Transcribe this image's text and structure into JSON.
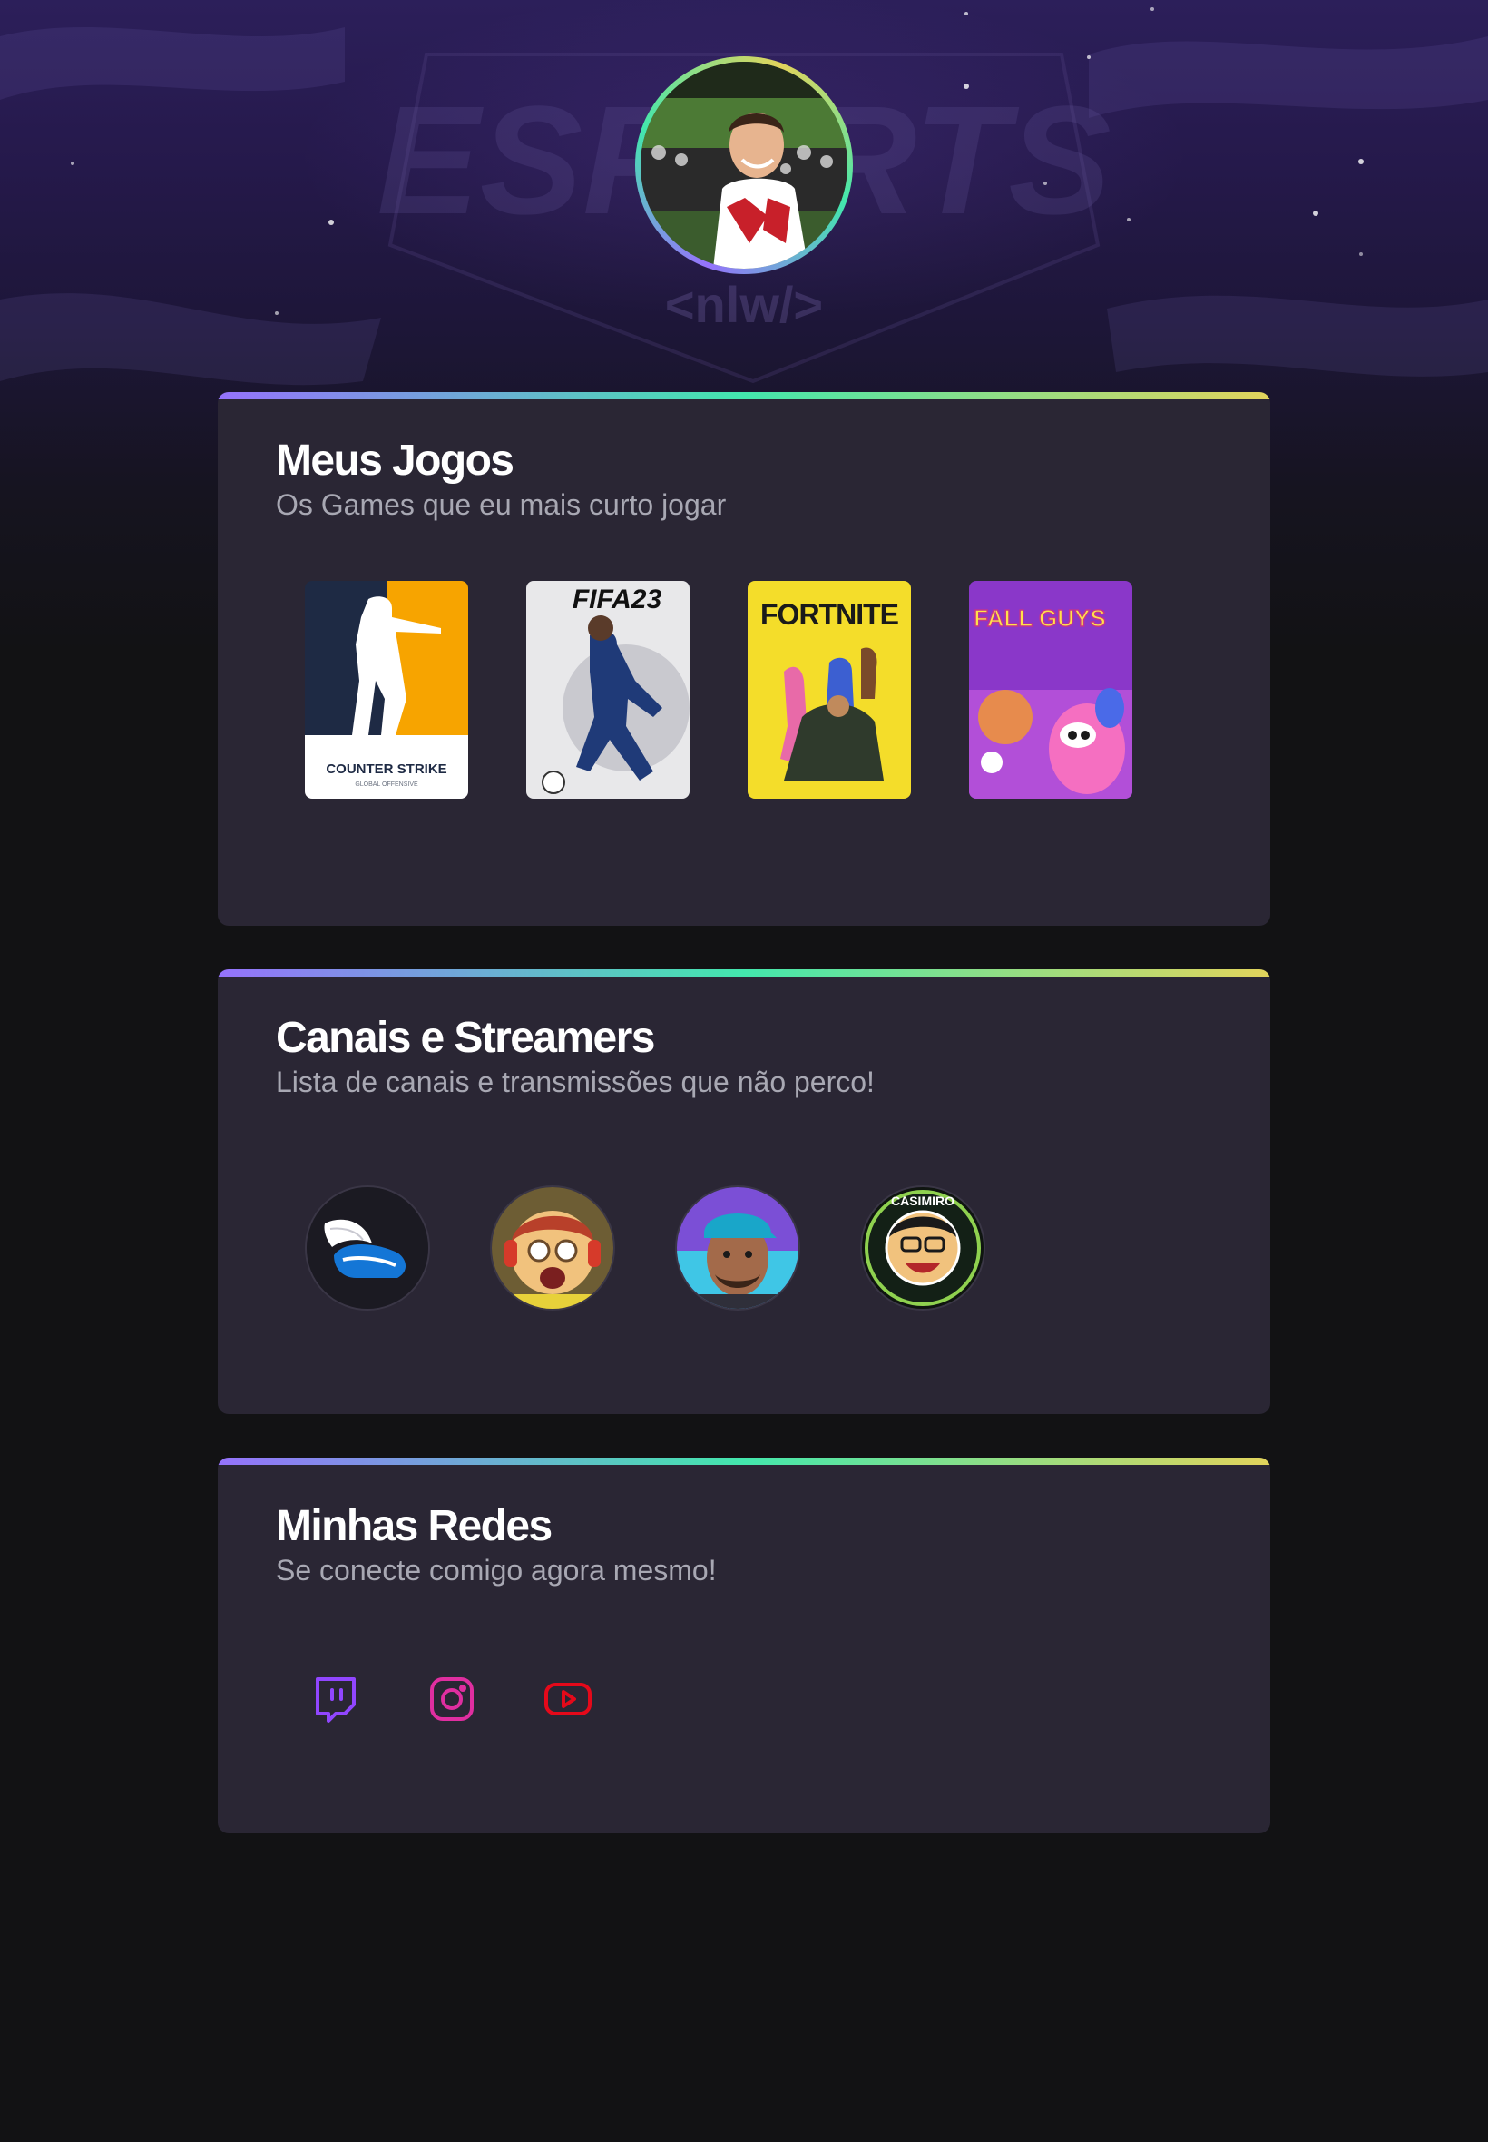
{
  "profile": {
    "avatar_alt": "Foto de perfil",
    "background_logo_text": "ESPORTS",
    "background_tag_text": "<nlw/>"
  },
  "sections": {
    "games": {
      "title": "Meus Jogos",
      "subtitle": "Os Games que eu mais curto jogar",
      "items": [
        {
          "name": "Counter Strike",
          "cover_text": "COUNTER STRIKE",
          "cover_subtext": "GLOBAL OFFENSIVE"
        },
        {
          "name": "FIFA 23",
          "cover_text": "FIFA23"
        },
        {
          "name": "Fortnite",
          "cover_text": "FORTNITE"
        },
        {
          "name": "Fall Guys",
          "cover_text": "FALL GUYS"
        }
      ]
    },
    "streamers": {
      "title": "Canais e Streamers",
      "subtitle": "Lista de canais e transmissões que não perco!",
      "items": [
        {
          "name": "channel-1"
        },
        {
          "name": "channel-2"
        },
        {
          "name": "channel-3"
        },
        {
          "name": "Casimiro",
          "badge_text": "CASIMIRO"
        }
      ]
    },
    "socials": {
      "title": "Minhas Redes",
      "subtitle": "Se conecte comigo agora mesmo!",
      "items": [
        {
          "name": "Twitch",
          "icon": "twitch-icon",
          "color": "#9146ff"
        },
        {
          "name": "Instagram",
          "icon": "instagram-icon",
          "color": "#e1306c"
        },
        {
          "name": "YouTube",
          "icon": "youtube-icon",
          "color": "#e5091a"
        }
      ]
    }
  },
  "colors": {
    "background": "#121214",
    "card": "#2a2634",
    "gradient": [
      "#9572fc",
      "#43e7ad",
      "#e2d45c"
    ],
    "subtitle": "#a8a8b3"
  }
}
